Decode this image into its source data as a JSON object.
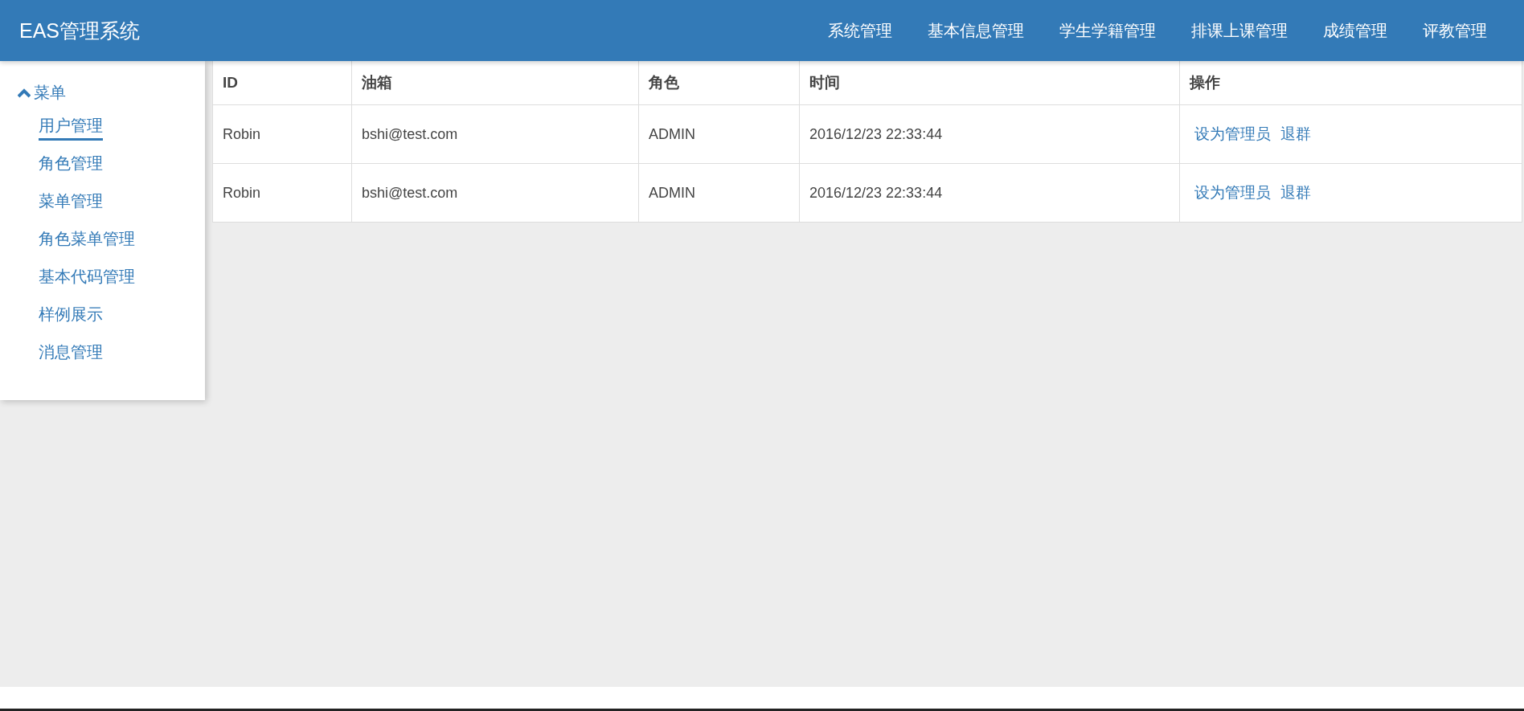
{
  "header": {
    "brand": "EAS管理系统",
    "nav": [
      "系统管理",
      "基本信息管理",
      "学生学籍管理",
      "排课上课管理",
      "成绩管理",
      "评教管理"
    ]
  },
  "sidebar": {
    "title": "菜单",
    "expanded": true,
    "items": [
      {
        "label": "用户管理",
        "selected": true
      },
      {
        "label": "角色管理",
        "selected": false
      },
      {
        "label": "菜单管理",
        "selected": false
      },
      {
        "label": "角色菜单管理",
        "selected": false
      },
      {
        "label": "基本代码管理",
        "selected": false
      },
      {
        "label": "样例展示",
        "selected": false
      },
      {
        "label": "消息管理",
        "selected": false
      }
    ]
  },
  "table": {
    "columns": [
      "ID",
      "油箱",
      "角色",
      "时间",
      "操作"
    ],
    "rows": [
      {
        "id": "Robin",
        "email": "bshi@test.com",
        "role": "ADMIN",
        "time": "2016/12/23 22:33:44",
        "actions": [
          "设为管理员",
          "退群"
        ]
      },
      {
        "id": "Robin",
        "email": "bshi@test.com",
        "role": "ADMIN",
        "time": "2016/12/23 22:33:44",
        "actions": [
          "设为管理员",
          "退群"
        ]
      }
    ]
  }
}
